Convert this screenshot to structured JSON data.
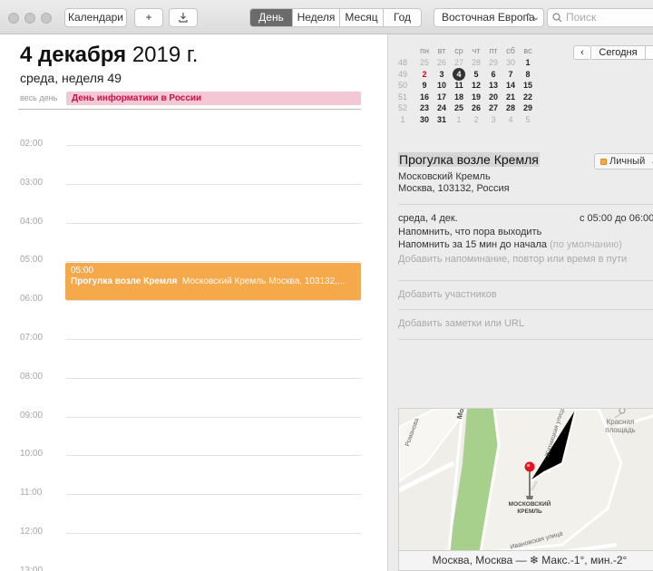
{
  "toolbar": {
    "calendars_label": "Календари",
    "add_label": "+",
    "views": [
      "День",
      "Неделя",
      "Месяц",
      "Год"
    ],
    "active_view": "День",
    "timezone": "Восточная Европа",
    "search_placeholder": "Поиск"
  },
  "day": {
    "date_bold": "4 декабря",
    "date_rest": "2019 г.",
    "subtitle": "среда, неделя 49",
    "allday_label": "весь день",
    "allday_event": "День информатики в России",
    "hours": [
      "02:00",
      "03:00",
      "04:00",
      "05:00",
      "06:00",
      "07:00",
      "08:00",
      "09:00",
      "10:00",
      "11:00",
      "12:00",
      "13:00"
    ],
    "event": {
      "time": "05:00",
      "title": "Прогулка возле Кремля",
      "location": "Московский Кремль Москва, 103132,..."
    }
  },
  "mini_calendar": {
    "weekdays": [
      "пн",
      "вт",
      "ср",
      "чт",
      "пт",
      "сб",
      "вс"
    ],
    "weeks": [
      {
        "wk": "48",
        "days": [
          "25",
          "26",
          "27",
          "28",
          "29",
          "30",
          "1"
        ]
      },
      {
        "wk": "49",
        "days": [
          "2",
          "3",
          "4",
          "5",
          "6",
          "7",
          "8"
        ]
      },
      {
        "wk": "50",
        "days": [
          "9",
          "10",
          "11",
          "12",
          "13",
          "14",
          "15"
        ]
      },
      {
        "wk": "51",
        "days": [
          "16",
          "17",
          "18",
          "19",
          "20",
          "21",
          "22"
        ]
      },
      {
        "wk": "52",
        "days": [
          "23",
          "24",
          "25",
          "26",
          "27",
          "28",
          "29"
        ]
      },
      {
        "wk": "1",
        "days": [
          "30",
          "31",
          "1",
          "2",
          "3",
          "4",
          "5"
        ]
      }
    ],
    "today_label": "Сегодня"
  },
  "detail": {
    "title": "Прогулка возле Кремля",
    "calendar": "Личный",
    "place_line1": "Московский Кремль",
    "place_line2": "Москва, 103132, Россия",
    "date": "среда, 4 дек.",
    "time": "с 05:00 до 06:00",
    "reminder1": "Напомнить, что пора выходить",
    "reminder2": "Напомнить за 15 мин до начала",
    "reminder2_default": "(по умолчанию)",
    "add_reminder": "Добавить напоминание, повтор или время в пути",
    "add_invitees": "Добавить участников",
    "add_notes": "Добавить заметки или URL"
  },
  "map": {
    "labels": {
      "red_square": "Красная площадь",
      "kremlin": "МОСКОВСКИЙ КРЕМЛЬ",
      "street1": "Моховая",
      "street2": "Романова",
      "street3": "Житницкая улица",
      "street4": "Ивановская улица"
    }
  },
  "weather": "Москва, Москва — ❄ Макс.-1°, мин.-2°",
  "colors": {
    "event": "#f5a94a",
    "allday": "#f4c7d4",
    "allday_text": "#c4134f",
    "today_circle": "#333333",
    "sunday_red": "#d0021b"
  }
}
